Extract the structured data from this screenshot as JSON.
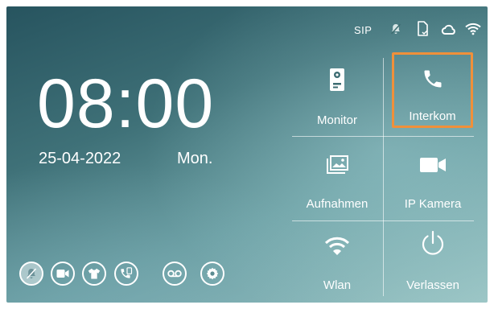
{
  "status_bar": {
    "sip_label": "SIP",
    "icons": [
      "bell-muted-icon",
      "sd-card-icon",
      "cloud-icon",
      "wifi-icon"
    ]
  },
  "clock": {
    "time": "08:00",
    "date": "25-04-2022",
    "weekday": "Mon."
  },
  "menu": {
    "items": [
      {
        "label": "Monitor",
        "icon": "door-station-icon"
      },
      {
        "label": "Interkom",
        "icon": "phone-icon",
        "highlighted": true
      },
      {
        "label": "Aufnahmen",
        "icon": "gallery-icon"
      },
      {
        "label": "IP Kamera",
        "icon": "video-camera-icon"
      },
      {
        "label": "Wlan",
        "icon": "wifi-icon"
      },
      {
        "label": "Verlassen",
        "icon": "power-icon"
      }
    ]
  },
  "quick_buttons": [
    "bell-muted-icon",
    "video-camera-icon",
    "shirt-icon",
    "phone-transfer-icon",
    "voicemail-icon",
    "settings-icon"
  ],
  "colors": {
    "highlight": "#f0903a"
  }
}
